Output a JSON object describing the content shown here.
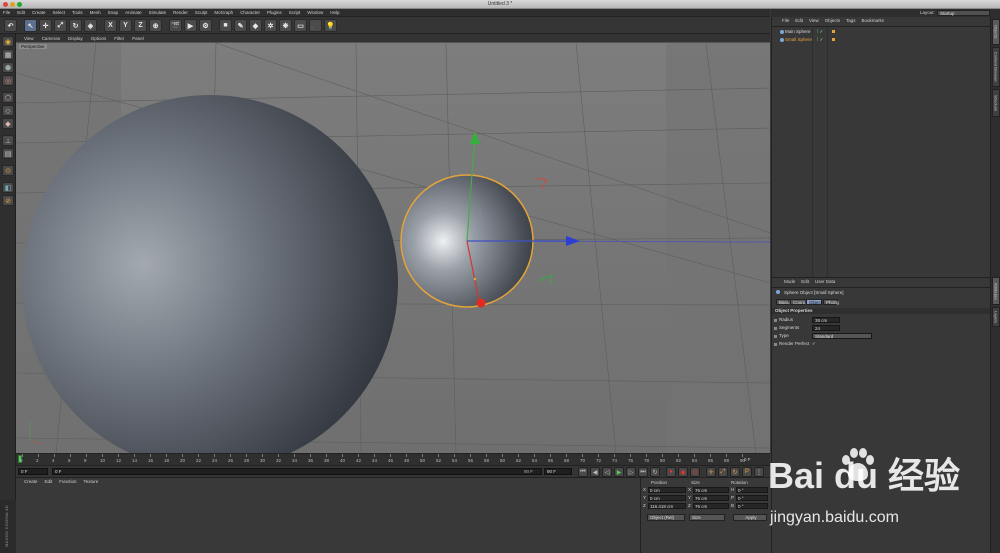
{
  "window": {
    "title": "Untitled 3 *"
  },
  "menubar": [
    "File",
    "Edit",
    "Create",
    "Select",
    "Tools",
    "Mesh",
    "Snap",
    "Animate",
    "Simulate",
    "Render",
    "Sculpt",
    "MoGraph",
    "Character",
    "Plugins",
    "Script",
    "Window",
    "Help"
  ],
  "layout": {
    "label": "Layout:",
    "value": "Startup"
  },
  "toolbar": {
    "icons": [
      "undo-icon",
      "select-arrow-icon",
      "move-icon",
      "scale-icon",
      "rotate-icon",
      "recent-tool-icon",
      "x-axis-icon",
      "y-axis-icon",
      "z-axis-icon",
      "world-coords-icon",
      "render-region-icon",
      "render-view-icon",
      "render-settings-icon",
      "cube-primitive-icon",
      "pen-spline-icon",
      "subdivision-icon",
      "array-icon",
      "deformer-icon",
      "floor-icon",
      "camera-icon",
      "light-icon"
    ],
    "glyphs": [
      "↶",
      "↖",
      "✛",
      "⤢",
      "↻",
      "◈",
      "X",
      "Y",
      "Z",
      "⊕",
      "🎬",
      "▶",
      "⚙",
      "■",
      "✎",
      "◆",
      "✲",
      "❋",
      "▭",
      "🎥",
      "💡"
    ]
  },
  "viewport": {
    "menu": [
      "View",
      "Cameras",
      "Display",
      "Options",
      "Filter",
      "Panel"
    ],
    "label": "Perspective"
  },
  "timeline": {
    "ticks": [
      "0",
      "2",
      "4",
      "6",
      "8",
      "10",
      "12",
      "14",
      "16",
      "18",
      "20",
      "22",
      "24",
      "26",
      "28",
      "30",
      "32",
      "34",
      "36",
      "38",
      "40",
      "42",
      "44",
      "46",
      "48",
      "50",
      "52",
      "54",
      "56",
      "58",
      "60",
      "62",
      "64",
      "66",
      "68",
      "70",
      "72",
      "74",
      "76",
      "78",
      "80",
      "82",
      "84",
      "86",
      "88",
      "90"
    ],
    "end_label": "0 F",
    "current_frame": "0 F",
    "start_field": "0 F",
    "end_field": "90 F",
    "end_field2": "90 F"
  },
  "material_manager": {
    "menu": [
      "Create",
      "Edit",
      "Function",
      "Texture"
    ]
  },
  "maxon": "MAXON CINEMA 4D",
  "coordinates": {
    "headers": [
      "Position",
      "Size",
      "Rotation"
    ],
    "rows": [
      {
        "axis": "X",
        "pos": "0 cm",
        "size_axis": "X",
        "size": "76 cm",
        "rot_axis": "H",
        "rot": "0 °"
      },
      {
        "axis": "Y",
        "pos": "0 cm",
        "size_axis": "Y",
        "size": "76 cm",
        "rot_axis": "P",
        "rot": "0 °"
      },
      {
        "axis": "Z",
        "pos": "116.418 cm",
        "size_axis": "Z",
        "size": "76 cm",
        "rot_axis": "B",
        "rot": "0 °"
      }
    ],
    "mode": "Object (Rel)",
    "size_mode": "Size",
    "apply": "Apply"
  },
  "object_manager": {
    "menu": [
      "File",
      "Edit",
      "View",
      "Objects",
      "Tags",
      "Bookmarks"
    ],
    "objects": [
      {
        "name": "Main Sphere",
        "selected": false
      },
      {
        "name": "Small Sphere",
        "selected": true
      }
    ]
  },
  "attribute_manager": {
    "menu": [
      "Mode",
      "Edit",
      "User Data"
    ],
    "header": "Sphere Object [Small Sphere]",
    "tabs": [
      "Basic",
      "Coord.",
      "Object",
      "Phong"
    ],
    "active_tab": "Object",
    "section": "Object Properties",
    "props": [
      {
        "label": "Radius",
        "value": "38 cm"
      },
      {
        "label": "Segments",
        "value": "24"
      },
      {
        "label": "Type",
        "value": "Standard"
      },
      {
        "label": "Render Perfect",
        "value": "✓"
      }
    ]
  },
  "side_tabs": [
    "Objects",
    "Content Browser",
    "Structure",
    "Attributes",
    "Layers"
  ],
  "watermark": {
    "brand": "Bai du 经验",
    "url": "jingyan.baidu.com"
  }
}
